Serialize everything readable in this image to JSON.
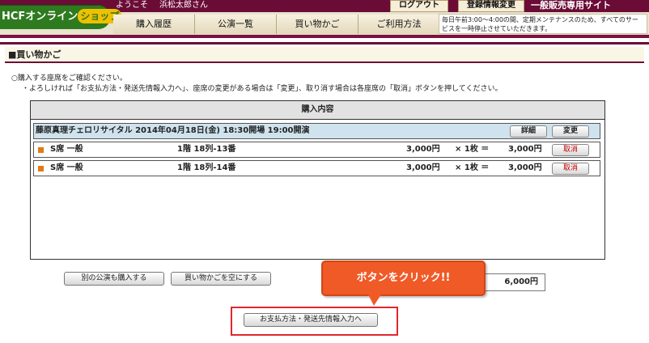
{
  "header": {
    "logo_text": "HCFオンライン",
    "logo_shop": "ショップ",
    "welcome": "ようこそ",
    "user_name": "浜松太郎さん",
    "logout_label": "ログアウト",
    "profile_label": "登録情報変更",
    "site_label": "一般販売専用サイト",
    "notice": "毎日午前3:00〜4:00の間、定期メンテナンスのため、すべてのサービスを一時停止させていただきます。",
    "nav": [
      "購入履歴",
      "公演一覧",
      "買い物かご",
      "ご利用方法"
    ]
  },
  "page": {
    "title": "■買い物かご",
    "instruction1": "○購入する座席をご確認ください。",
    "instruction2": "・よろしければ「お支払方法・発送先情報入力へ」、座席の変更がある場合は「変更」、取り消す場合は各座席の「取消」ボタンを押してください。"
  },
  "cart": {
    "header": "購入内容",
    "event": "藤原真理チェロリサイタル 2014年04月18日(金) 18:30開場 19:00開演",
    "detail_label": "詳細",
    "change_label": "変更",
    "seats": [
      {
        "grade": "S席 一般",
        "seat": "1階 18列-13番",
        "price": "3,000円",
        "qty": "× 1枚 ＝",
        "subtotal": "3,000円",
        "cancel": "取消"
      },
      {
        "grade": "S席 一般",
        "seat": "1階 18列-14番",
        "price": "3,000円",
        "qty": "× 1枚 ＝",
        "subtotal": "3,000円",
        "cancel": "取消"
      }
    ]
  },
  "footer": {
    "other_label": "別の公演も購入する",
    "empty_label": "買い物かごを空にする",
    "total": "6,000円",
    "callout": "ボタンをクリック!!",
    "proceed_label": "お支払方法・発送先情報入力へ"
  },
  "colors": {
    "brand": "#6b0c36",
    "logo_green": "#2e7a1f",
    "event_row": "#cfe3ee",
    "callout": "#f05a26",
    "highlight": "#e3262f"
  }
}
